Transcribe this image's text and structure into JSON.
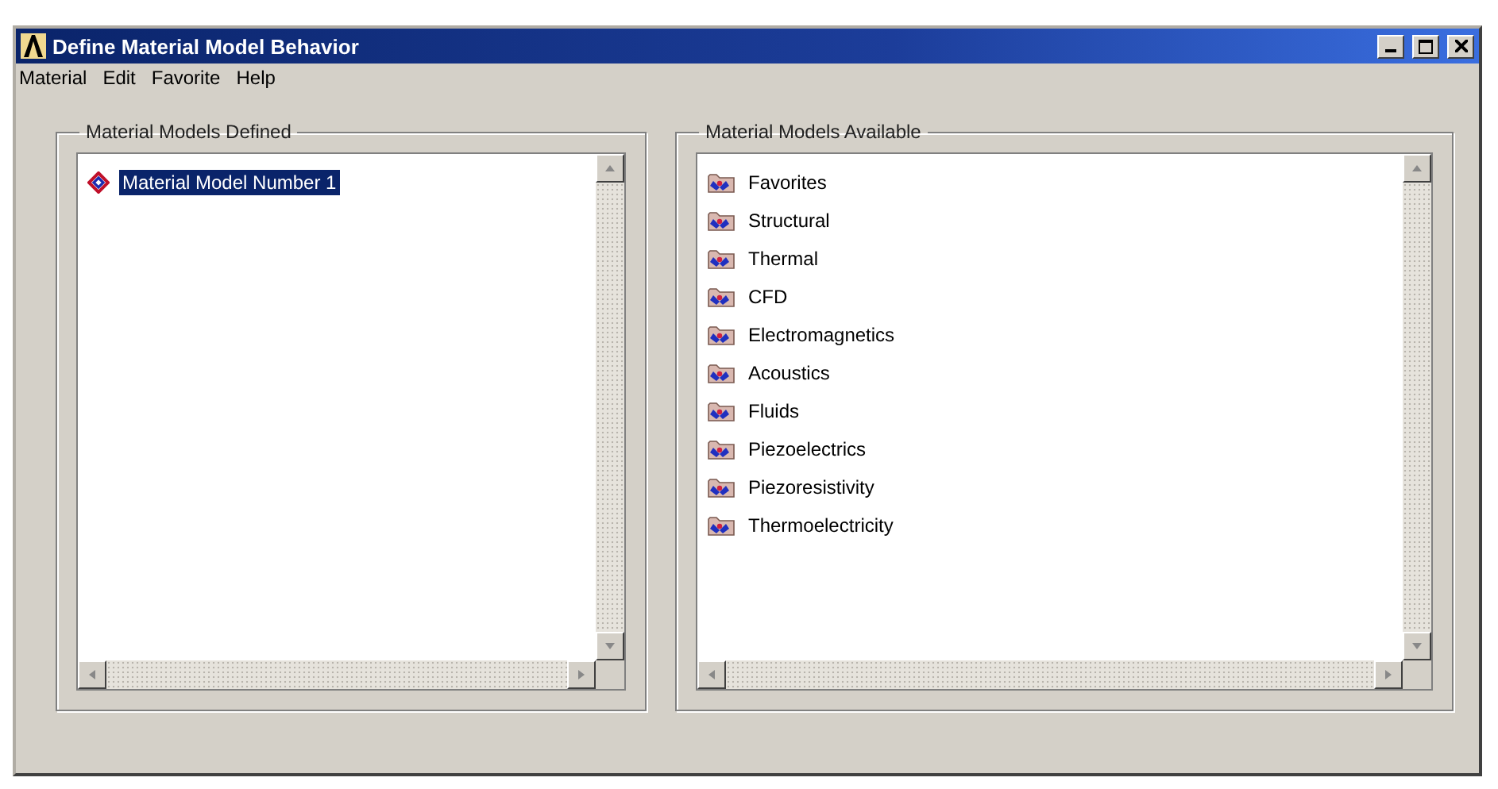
{
  "window": {
    "title": "Define Material Model Behavior"
  },
  "menu": [
    "Material",
    "Edit",
    "Favorite",
    "Help"
  ],
  "defined": {
    "title": "Material Models Defined",
    "items": [
      {
        "label": "Material Model Number 1",
        "selected": true
      }
    ]
  },
  "available": {
    "title": "Material Models Available",
    "items": [
      {
        "label": "Favorites",
        "selected": false
      },
      {
        "label": "Structural",
        "selected": false
      },
      {
        "label": "Thermal",
        "selected": false
      },
      {
        "label": "CFD",
        "selected": false
      },
      {
        "label": "Electromagnetics",
        "selected": false
      },
      {
        "label": "Acoustics",
        "selected": false
      },
      {
        "label": "Fluids",
        "selected": false
      },
      {
        "label": "Piezoelectrics",
        "selected": false
      },
      {
        "label": "Piezoresistivity",
        "selected": false
      },
      {
        "label": "Thermoelectricity",
        "selected": false
      }
    ]
  }
}
